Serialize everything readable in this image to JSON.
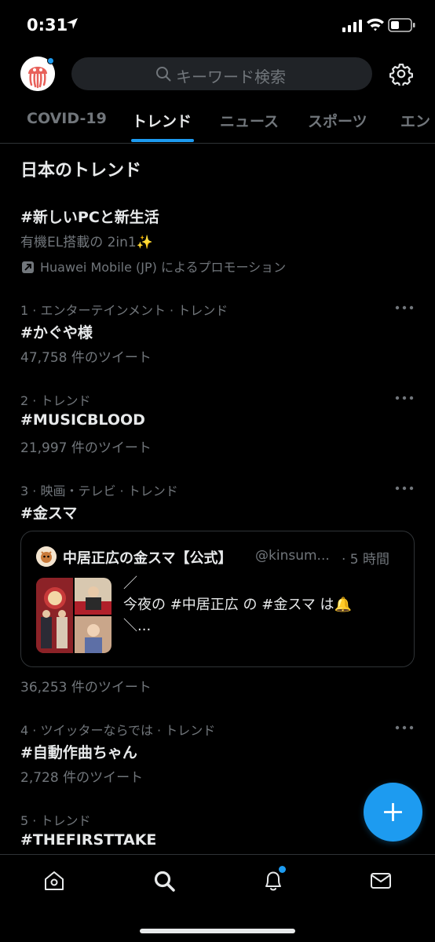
{
  "status_bar": {
    "time": "0:31"
  },
  "header": {
    "search_placeholder": "キーワード検索"
  },
  "tabs": [
    {
      "label": "COVID-19"
    },
    {
      "label": "トレンド"
    },
    {
      "label": "ニュース"
    },
    {
      "label": "スポーツ"
    },
    {
      "label": "エン"
    }
  ],
  "section_title": "日本のトレンド",
  "promo": {
    "name": "#新しいPCと新生活",
    "description": "有機EL搭載の 2in1✨",
    "promoted_by": "Huawei Mobile (JP) によるプロモーション"
  },
  "trends": [
    {
      "meta": "1 · エンターテインメント · トレンド",
      "name": "#かぐや様",
      "count": "47,758 件のツイート"
    },
    {
      "meta": "2 · トレンド",
      "name": "#MUSICBLOOD",
      "count": "21,997 件のツイート"
    },
    {
      "meta": "3 · 映画・テレビ · トレンド",
      "name": "#金スマ",
      "count": "36,253 件のツイート"
    },
    {
      "meta": "4 · ツイッターならでは · トレンド",
      "name": "#自動作曲ちゃん",
      "count": "2,728 件のツイート"
    },
    {
      "meta": "5 · トレンド",
      "name": "#THEFIRSTTAKE"
    }
  ],
  "tweet_card": {
    "author": "中居正広の金スマ【公式】",
    "handle": "@kinsum...",
    "time": "· 5 時間",
    "text": "／\n今夜の #中居正広 の #金スマ は🔔\n＼..."
  },
  "colors": {
    "accent": "#1d9bf0",
    "background": "#000000",
    "secondary_text": "#71767b"
  }
}
